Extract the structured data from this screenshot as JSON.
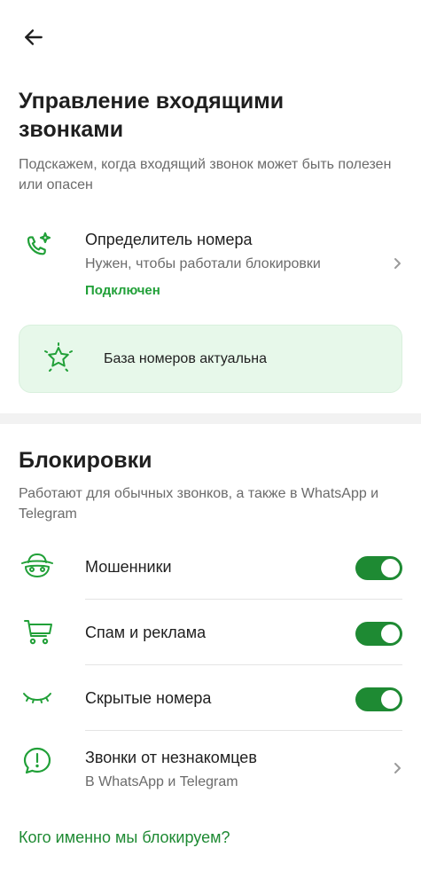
{
  "header": {
    "back_icon": "arrow-left-icon"
  },
  "title": "Управление входящими звонками",
  "subtitle": "Подскажем, когда входящий звонок может быть полезен или опасен",
  "caller_id": {
    "icon": "phone-sparkle-icon",
    "title": "Определитель номера",
    "description": "Нужен, чтобы работали блокировки",
    "status": "Подключен"
  },
  "database_card": {
    "icon": "star-sparkle-icon",
    "text": "База номеров актуальна"
  },
  "blocking": {
    "title": "Блокировки",
    "subtitle": "Работают для обычных звонков, а также в WhatsApp и Telegram",
    "items": [
      {
        "label": "Мошенники",
        "icon": "masked-hat-icon",
        "enabled": true
      },
      {
        "label": "Спам и реклама",
        "icon": "shopping-cart-icon",
        "enabled": true
      },
      {
        "label": "Скрытые номера",
        "icon": "closed-eye-icon",
        "enabled": true
      }
    ],
    "strangers": {
      "title": "Звонки от незнакомцев",
      "description": "В WhatsApp и Telegram",
      "icon": "exclamation-chat-icon"
    }
  },
  "link_text": "Кого именно мы блокируем?",
  "colors": {
    "accent": "#21a038",
    "switch_on": "#1e8a33",
    "card_bg": "#e7f8ea"
  }
}
